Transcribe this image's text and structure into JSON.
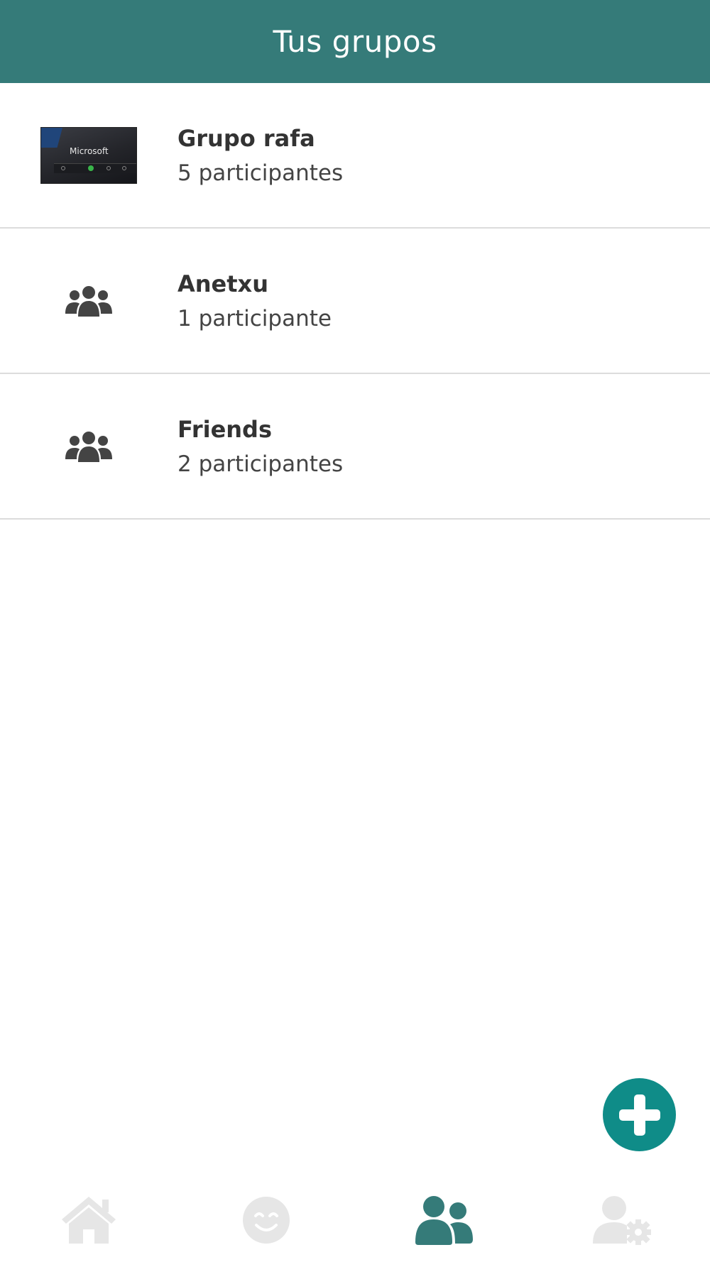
{
  "header": {
    "title": "Tus grupos"
  },
  "groups": [
    {
      "name": "Grupo rafa",
      "count": "5 participantes",
      "thumbnail": "photo",
      "photo_text": "Microsoft"
    },
    {
      "name": "Anetxu",
      "count": "1 participante",
      "thumbnail": "users-icon"
    },
    {
      "name": "Friends",
      "count": "2 participantes",
      "thumbnail": "users-icon"
    }
  ],
  "fab": {
    "icon": "plus-icon",
    "color": "#0f8c88"
  },
  "bottom_nav": [
    {
      "icon": "home-icon",
      "active": false
    },
    {
      "icon": "smiley-icon",
      "active": false
    },
    {
      "icon": "group-icon",
      "active": true
    },
    {
      "icon": "user-settings-icon",
      "active": false
    }
  ],
  "colors": {
    "header_bg": "#357b79",
    "active_nav": "#357b79",
    "inactive_nav": "#e6e6e6",
    "icon": "#444444"
  }
}
